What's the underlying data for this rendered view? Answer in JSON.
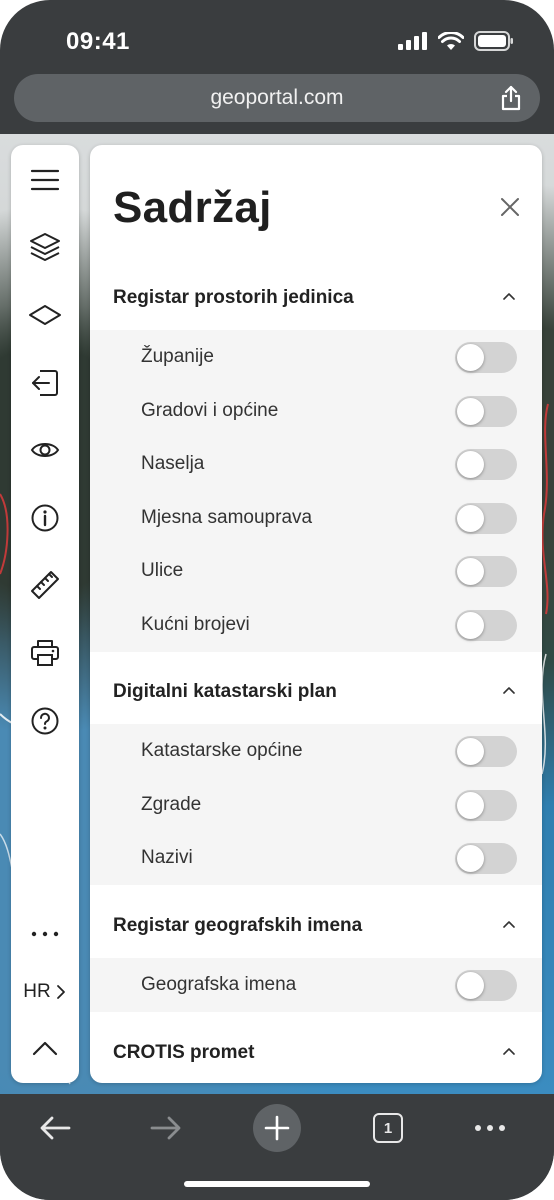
{
  "status": {
    "time": "09:41"
  },
  "browser": {
    "url": "geoportal.com",
    "tab_count": "1"
  },
  "sidebar": {
    "language": "HR"
  },
  "panel": {
    "title": "Sadržaj",
    "sections": [
      {
        "title": "Registar prostorih jedinica",
        "items": [
          "Županije",
          "Gradovi i općine",
          "Naselja",
          "Mjesna samouprava",
          "Ulice",
          "Kućni brojevi"
        ]
      },
      {
        "title": "Digitalni katastarski plan",
        "items": [
          "Katastarske općine",
          "Zgrade",
          "Nazivi"
        ]
      },
      {
        "title": "Registar geografskih imena",
        "items": [
          "Geografska imena"
        ]
      },
      {
        "title": "CROTIS promet",
        "items": []
      }
    ]
  },
  "colors": {
    "toggle_off": "#d3d3d3",
    "chrome": "#3a3d3f",
    "urlbar": "#5f6366"
  }
}
